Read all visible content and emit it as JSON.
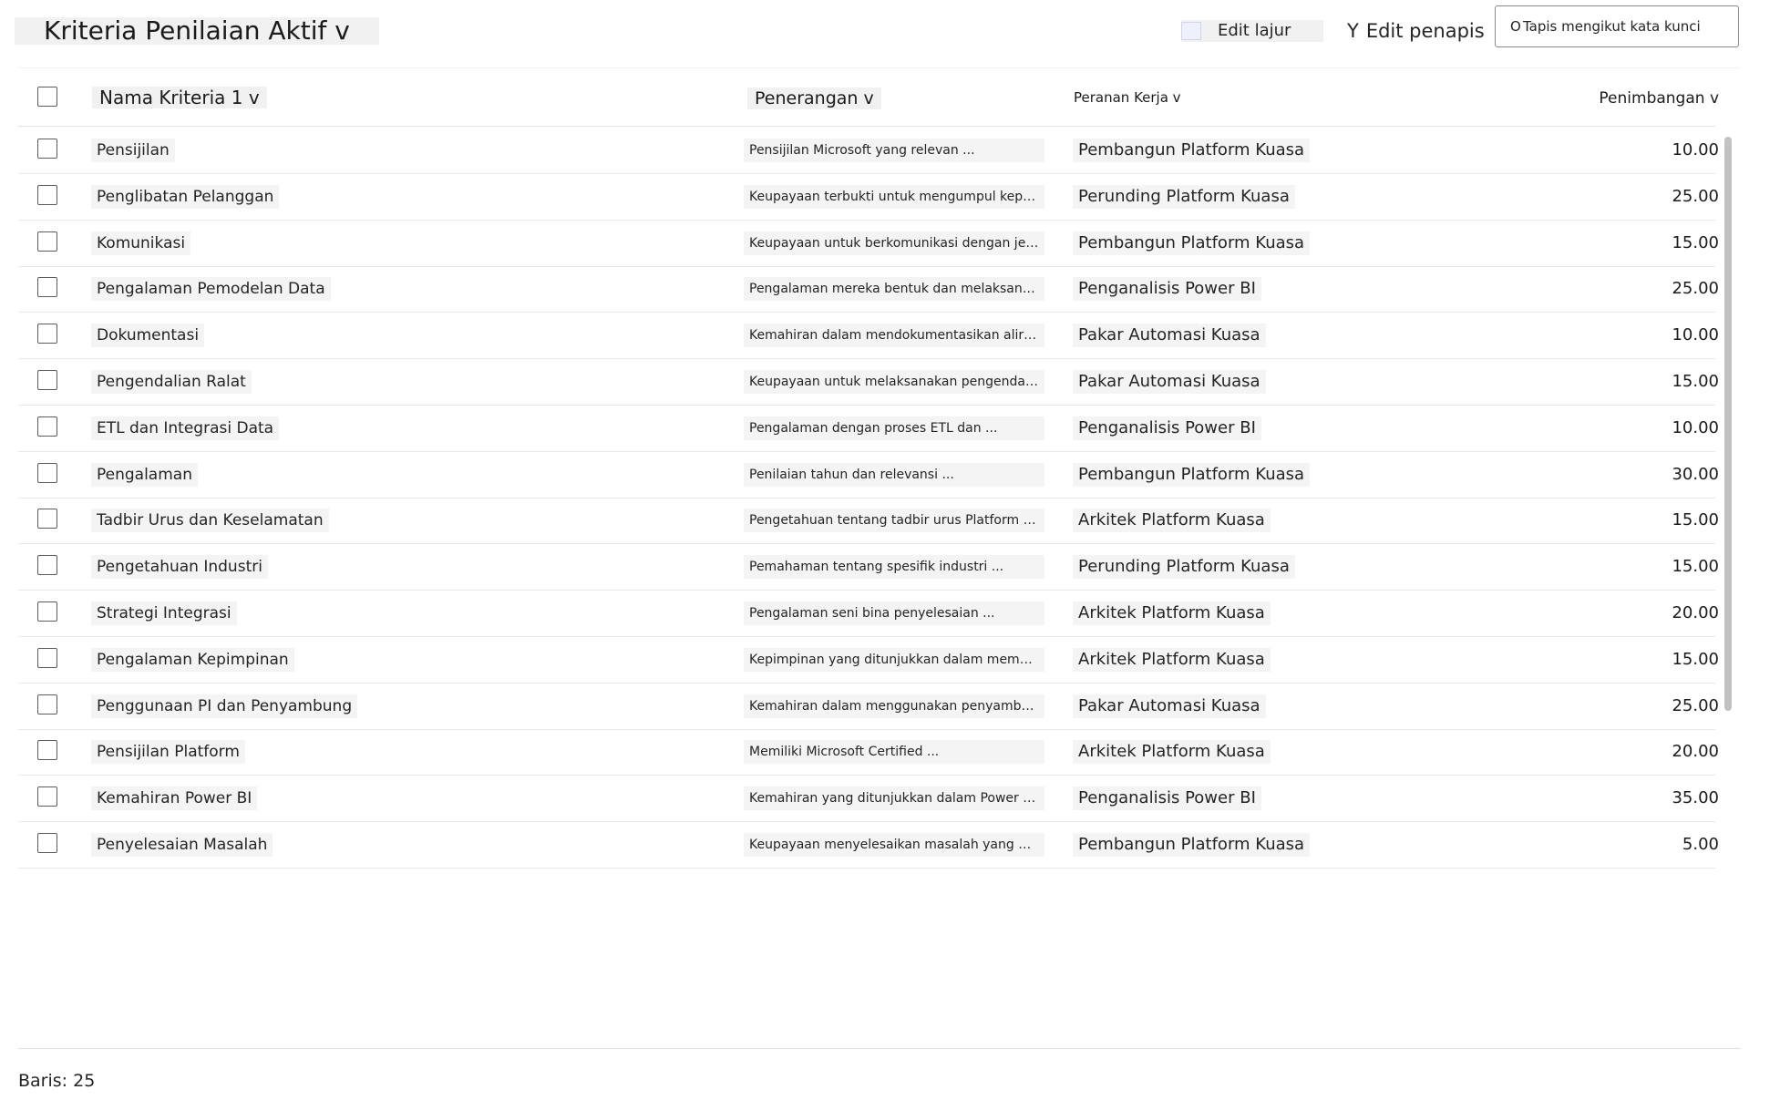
{
  "view": {
    "title": "Kriteria Penilaian Aktif v"
  },
  "toolbar": {
    "edit_columns_label": "Edit lajur",
    "edit_filters_label": "Edit penapis",
    "filter_glyph": "Y",
    "filter_icon": "filter-icon",
    "columns_icon": "columns-icon"
  },
  "search": {
    "placeholder": "Tapis mengikut kata kunci",
    "value": "",
    "glyph": "O",
    "icon": "search-icon"
  },
  "columns": {
    "name": "Nama Kriteria 1 v",
    "description": "Penerangan v",
    "role": "Peranan Kerja v",
    "weight": "Penimbangan v"
  },
  "rows": [
    {
      "name": "Pensijilan",
      "description": "Pensijilan Microsoft yang relevan ...",
      "role": "Pembangun Platform Kuasa",
      "weight": "10.00"
    },
    {
      "name": "Penglibatan Pelanggan",
      "description": "Keupayaan terbukti untuk mengumpul keperluan ...",
      "role": "Perunding Platform Kuasa",
      "weight": "25.00"
    },
    {
      "name": "Komunikasi",
      "description": "Keupayaan untuk berkomunikasi dengan jelas ...",
      "role": "Pembangun Platform Kuasa",
      "weight": "15.00"
    },
    {
      "name": "Pengalaman Pemodelan Data",
      "description": "Pengalaman mereka bentuk dan melaksanakan ...",
      "role": "Penganalisis Power BI",
      "weight": "25.00"
    },
    {
      "name": "Dokumentasi",
      "description": "Kemahiran dalam mendokumentasikan aliran kerja ...",
      "role": "Pakar Automasi Kuasa",
      "weight": "10.00"
    },
    {
      "name": "Pengendalian Ralat",
      "description": "Keupayaan untuk melaksanakan pengendalian ralat yang kukuh ...",
      "role": "Pakar Automasi Kuasa",
      "weight": "15.00"
    },
    {
      "name": "ETL dan Integrasi Data",
      "description": "Pengalaman dengan proses ETL dan ...",
      "role": "Penganalisis Power BI",
      "weight": "10.00"
    },
    {
      "name": "Pengalaman",
      "description": "Penilaian tahun dan relevansi ...",
      "role": "Pembangun Platform Kuasa",
      "weight": "30.00"
    },
    {
      "name": "Tadbir Urus dan Keselamatan",
      "description": "Pengetahuan tentang tadbir urus Platform Kuasa ...",
      "role": "Arkitek Platform Kuasa",
      "weight": "15.00"
    },
    {
      "name": "Pengetahuan Industri",
      "description": "Pemahaman tentang spesifik industri ...",
      "role": "Perunding Platform Kuasa",
      "weight": "15.00"
    },
    {
      "name": "Strategi Integrasi",
      "description": "Pengalaman seni bina penyelesaian ...",
      "role": "Arkitek Platform Kuasa",
      "weight": "20.00"
    },
    {
      "name": "Pengalaman Kepimpinan",
      "description": "Kepimpinan yang ditunjukkan dalam membimbing ...",
      "role": "Arkitek Platform Kuasa",
      "weight": "15.00"
    },
    {
      "name": "Penggunaan PI dan Penyambung",
      "description": "Kemahiran dalam menggunakan penyambung standard dan ...",
      "role": "Pakar Automasi Kuasa",
      "weight": "25.00"
    },
    {
      "name": "Pensijilan Platform",
      "description": "Memiliki Microsoft Certified ...",
      "role": "Arkitek Platform Kuasa",
      "weight": "20.00"
    },
    {
      "name": "Kemahiran Power BI",
      "description": "Kemahiran yang ditunjukkan dalam Power BI ...",
      "role": "Penganalisis Power BI",
      "weight": "35.00"
    },
    {
      "name": "Penyelesaian Masalah",
      "description": "Keupayaan menyelesaikan masalah yang ditunjukkan ...",
      "role": "Pembangun Platform Kuasa",
      "weight": "5.00"
    }
  ],
  "footer": {
    "row_count_text": "Baris: 25"
  }
}
